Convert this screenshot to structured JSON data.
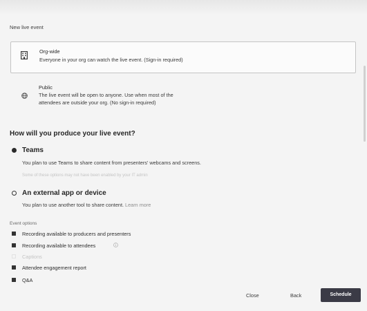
{
  "window": {
    "title": "New live event"
  },
  "permissions": {
    "org_wide": {
      "label": "Org-wide",
      "description": "Everyone in your org can watch the live event. (Sign-in required)",
      "icon": "building-icon",
      "selected": true
    },
    "public": {
      "label": "Public",
      "description_line1": "The live event will be open to anyone. Use when most of the",
      "description_line2": "attendees are outside your org. (No sign-in required)",
      "icon": "globe-icon",
      "selected": false
    }
  },
  "produce": {
    "heading": "How will you produce your live event?",
    "options": [
      {
        "title": "Teams",
        "description": "You plan to use Teams to share content from presenters' webcams and screens.",
        "note": "Some of these options may not have been enabled by your IT admin",
        "selected": true
      },
      {
        "title": "An external app or device",
        "description": "You plan to use another tool to share content.",
        "link": "Learn more",
        "selected": false
      }
    ]
  },
  "event_options": {
    "label": "Event options",
    "items": [
      {
        "label": "Recording available to producers and presenters",
        "checked": true
      },
      {
        "label": "Recording available to attendees",
        "checked": true,
        "icon": "info-icon"
      },
      {
        "label": "Captions",
        "checked": false,
        "disabled": true
      },
      {
        "label": "Attendee engagement report",
        "checked": true
      },
      {
        "label": "Q&A",
        "checked": true
      }
    ]
  },
  "footer": {
    "close": "Close",
    "back": "Back",
    "schedule": "Schedule"
  },
  "colors": {
    "schedule_button": "#3b3b46",
    "text": "#2a2a2a",
    "faint_text": "#c4c4c4",
    "background": "#f4f4f4"
  }
}
